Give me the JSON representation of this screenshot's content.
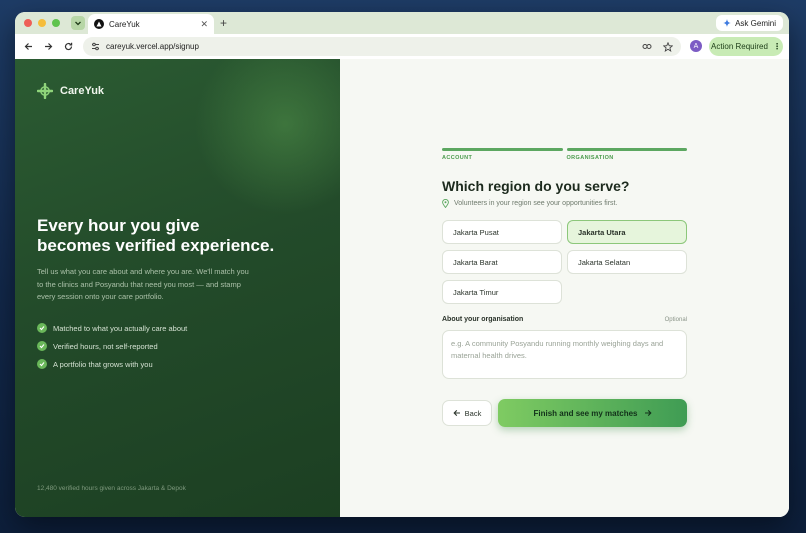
{
  "browser": {
    "tab_title": "CareYuk",
    "url": "careyuk.vercel.app/signup",
    "ask_gemini": "Ask Gemini",
    "avatar_letter": "A",
    "action_required": "Action Required"
  },
  "left": {
    "brand": "CareYuk",
    "headline_line1": "Every hour you give",
    "headline_line2": "becomes verified experience.",
    "intro": "Tell us what you care about and where you are. We'll match you to the clinics and Posyandu that need you most — and stamp every session onto your care portfolio.",
    "features": [
      "Matched to what you actually care about",
      "Verified hours, not self-reported",
      "A portfolio that grows with you"
    ],
    "footer_note": "12,480 verified hours given across Jakarta & Depok"
  },
  "form": {
    "steps": [
      "ACCOUNT",
      "ORGANISATION"
    ],
    "title": "Which region do you serve?",
    "subtitle": "Volunteers in your region see your opportunities first.",
    "regions": [
      {
        "label": "Jakarta Pusat",
        "selected": false
      },
      {
        "label": "Jakarta Utara",
        "selected": true
      },
      {
        "label": "Jakarta Barat",
        "selected": false
      },
      {
        "label": "Jakarta Selatan",
        "selected": false
      },
      {
        "label": "Jakarta Timur",
        "selected": false
      }
    ],
    "about_label": "About your organisation",
    "optional_label": "Optional",
    "about_value": "",
    "about_placeholder": "e.g. A community Posyandu running monthly weighing days and maternal health drives.",
    "back_label": "Back",
    "finish_label": "Finish and see my matches"
  },
  "colors": {
    "accent": "#5ca760",
    "panel_dark": "#234b2a",
    "selected_bg": "#e6f5dc"
  }
}
